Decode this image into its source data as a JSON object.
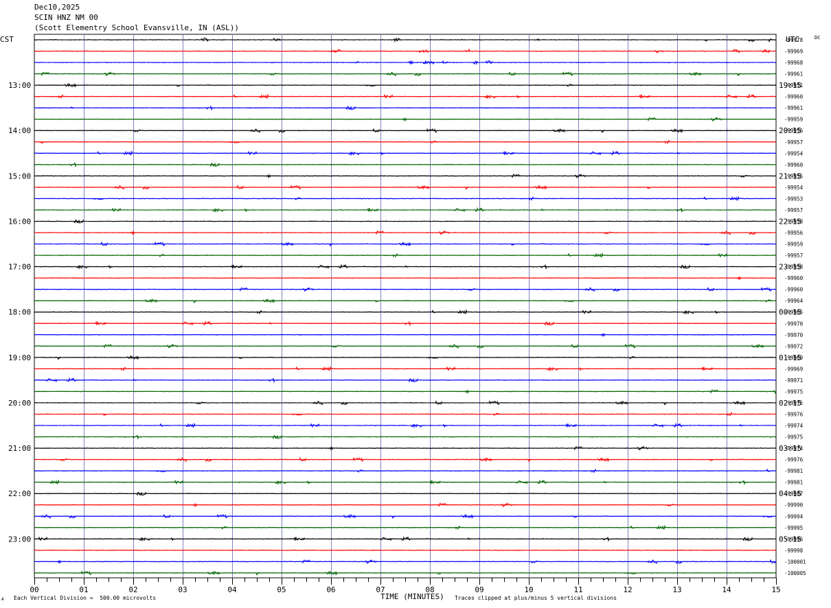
{
  "header": {
    "date": "Dec10,2025",
    "station": "SCIN HNZ NM 00",
    "location": "(Scott Elementry School Evansville, IN (ASL))"
  },
  "left_axis_label": "CST",
  "right_axis_label": "UTC",
  "dc_label": "DC",
  "footer": {
    "scale_note": "Each Vertical Division =  500.00 microvolts",
    "xlabel": "TIME (MINUTES)",
    "clip_note": "Traces clipped at plus/minus 5 vertical divisions",
    "corner_mark": "A"
  },
  "colors": {
    "trace_cycle": [
      "#000000",
      "#ff0000",
      "#0000ff",
      "#006400"
    ],
    "minute_grid": "#8080c0",
    "frame": "#000000"
  },
  "chart_data": {
    "type": "line",
    "description_units": "helicorder: 15-minute rows, x in minutes",
    "xlim": [
      0,
      15
    ],
    "x_ticks": [
      "00",
      "01",
      "02",
      "03",
      "04",
      "05",
      "06",
      "07",
      "08",
      "09",
      "10",
      "11",
      "12",
      "13",
      "14",
      "15"
    ],
    "left_hour_labels": [
      "13:00",
      "14:00",
      "15:00",
      "16:00",
      "17:00",
      "18:00",
      "19:00",
      "20:00",
      "21:00",
      "22:00",
      "23:00"
    ],
    "right_hour_labels": [
      "19:15",
      "20:15",
      "21:15",
      "22:15",
      "23:15",
      "00:15",
      "01:15",
      "02:15",
      "03:15",
      "04:15",
      "05:15"
    ],
    "row_dc_offsets": [
      "-99978",
      "-99969",
      "-99968",
      "-99961",
      "-99951",
      "-99960",
      "-99961",
      "-99959",
      "-99956",
      "-99957",
      "-99954",
      "-99960",
      "-99955",
      "-99954",
      "-99953",
      "-99957",
      "-99958",
      "-99956",
      "-99959",
      "-99957",
      "-99958",
      "-99960",
      "-99960",
      "-99964",
      "-99965",
      "-99970",
      "-99970",
      "-99972",
      "-99969",
      "-99969",
      "-99971",
      "-99975",
      "-99975",
      "-99976",
      "-99974",
      "-99975",
      "-99974",
      "-99976",
      "-99981",
      "-99981",
      "-99987",
      "-99990",
      "-99994",
      "-99995",
      "-99996",
      "-99998",
      "-100001",
      "-100005"
    ],
    "rows_with_trace": 48,
    "grid": true
  }
}
